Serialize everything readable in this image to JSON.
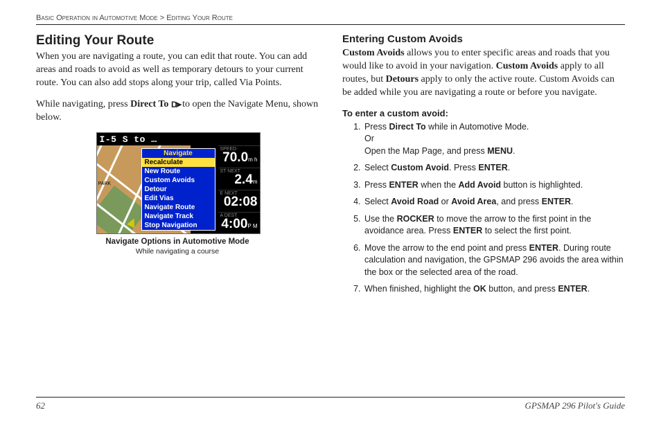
{
  "breadcrumb": {
    "part1": "Basic Operation in Automotive Mode",
    "sep": ">",
    "part2": "Editing Your Route"
  },
  "left": {
    "h1": "Editing Your Route",
    "p1": "When you are navigating a route, you can edit that route. You can add areas and roads to avoid as well as temporary detours to your current route. You can also add stops along your trip, called Via Points.",
    "p2a": "While navigating, press ",
    "p2b": "Direct To",
    "p2c": " to open the Navigate Menu, shown below.",
    "fig_caption1": "Navigate Options in Automotive Mode",
    "fig_caption2": "While navigating a course"
  },
  "device": {
    "topbar": "I-5 S to …",
    "parklabel": "PARK",
    "sidebar": {
      "speed_label": "SPEED",
      "speed_val": "70.0",
      "speed_unit": "m h",
      "dist_label": "ST NEXT",
      "dist_val": "2.4",
      "dist_unit": "m",
      "time_label": "E NEXT",
      "time_val": "02:08",
      "dest_label": "A DEST",
      "dest_val": "4:00",
      "dest_unit": "P M"
    },
    "menu": {
      "title": "Navigate",
      "items": [
        "Recalculate",
        "New Route",
        "Custom Avoids",
        "Detour",
        "Edit Vias",
        "Navigate Route",
        "Navigate Track",
        "Stop Navigation"
      ],
      "highlighted_index": 0
    }
  },
  "right": {
    "h2": "Entering Custom Avoids",
    "p1_parts": [
      "Custom Avoids",
      " allows you to enter specific areas and roads that you would like to avoid in your navigation. ",
      "Custom Avoids",
      " apply to all routes, but ",
      "Detours",
      " apply to only the active route. Custom Avoids can be added while you are navigating a route or before you navigate."
    ],
    "h3": "To enter a custom avoid:",
    "steps": [
      {
        "frag": [
          "Press ",
          "<b>Direct To</b> <dto>",
          " while in Automotive Mode.",
          "<br>",
          "Or",
          "<br>",
          "Open the Map Page, and press ",
          "<b>MENU</b>",
          "."
        ]
      },
      {
        "frag": [
          "Select ",
          "<b>Custom Avoid</b>",
          ". Press ",
          "<b>ENTER</b>",
          "."
        ]
      },
      {
        "frag": [
          "Press ",
          "<b>ENTER</b>",
          " when the ",
          "<b>Add Avoid</b>",
          " button is highlighted."
        ]
      },
      {
        "frag": [
          "Select ",
          "<b>Avoid Road</b>",
          " or ",
          "<b>Avoid Area</b>",
          ", and press ",
          "<b>ENTER</b>",
          "."
        ]
      },
      {
        "frag": [
          "Use the ",
          "<b>ROCKER</b>",
          " to move the arrow to the first point in the avoidance area. Press ",
          "<b>ENTER</b>",
          " to select the first point."
        ]
      },
      {
        "frag": [
          "Move the arrow to the end point and press ",
          "<b>ENTER</b>",
          ". During route calculation and navigation, the GPSMAP 296 avoids the area within the box or the selected area of the road."
        ]
      },
      {
        "frag": [
          "When finished, highlight the ",
          "<b>OK</b>",
          " button, and press ",
          "<b>ENTER</b>",
          "."
        ]
      }
    ]
  },
  "footer": {
    "page": "62",
    "guide": "GPSMAP 296 Pilot's Guide"
  },
  "icons": {
    "direct_to_glyph": "D➤"
  }
}
